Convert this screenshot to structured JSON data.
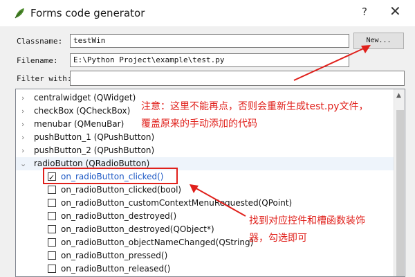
{
  "window": {
    "title": "Forms code generator",
    "help": "?",
    "close": "✕"
  },
  "form": {
    "classname_label": "Classname:",
    "classname_value": "testWin",
    "new_button": "New...",
    "filename_label": "Filename:",
    "filename_value": "E:\\Python Project\\example\\test.py",
    "filter_label": "Filter with:",
    "filter_value": ""
  },
  "tree": {
    "rows": [
      {
        "label": "centralwidget (QWidget)",
        "expanded": false
      },
      {
        "label": "checkBox (QCheckBox)",
        "expanded": false
      },
      {
        "label": "menubar (QMenuBar)",
        "expanded": false
      },
      {
        "label": "pushButton_1 (QPushButton)",
        "expanded": false
      },
      {
        "label": "pushButton_2 (QPushButton)",
        "expanded": false
      },
      {
        "label": "radioButton (QRadioButton)",
        "expanded": true
      }
    ],
    "slots": [
      {
        "label": "on_radioButton_clicked()",
        "checked": true
      },
      {
        "label": "on_radioButton_clicked(bool)",
        "checked": false
      },
      {
        "label": "on_radioButton_customContextMenuRequested(QPoint)",
        "checked": false
      },
      {
        "label": "on_radioButton_destroyed()",
        "checked": false
      },
      {
        "label": "on_radioButton_destroyed(QObject*)",
        "checked": false
      },
      {
        "label": "on_radioButton_objectNameChanged(QString)",
        "checked": false
      },
      {
        "label": "on_radioButton_pressed()",
        "checked": false
      },
      {
        "label": "on_radioButton_released()",
        "checked": false
      }
    ]
  },
  "annotations": {
    "note_line1": "注意：这里不能再点，否则会重新生成test.py文件，",
    "note_line2": "覆盖原来的手动添加的代码",
    "hint_line1": "找到对应控件和槽函数装饰",
    "hint_line2": "器，勾选即可"
  },
  "colors": {
    "annotation": "#e0201b",
    "selected_slot_text": "#1a56c4",
    "selected_row_bg": "#eef4fb"
  }
}
